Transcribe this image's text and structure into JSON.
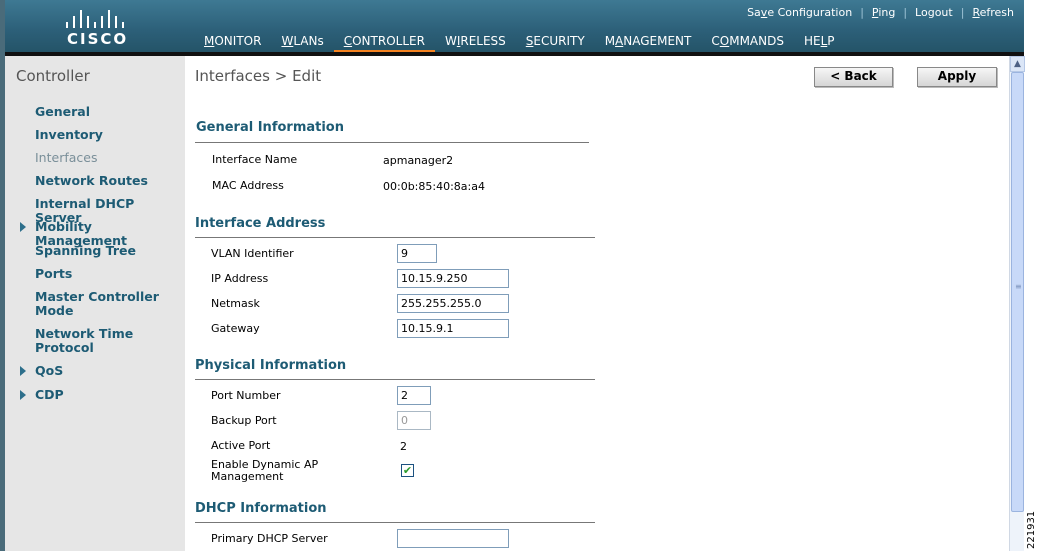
{
  "header": {
    "logo_text": "CISCO",
    "top_links": [
      {
        "pre": "Sa",
        "u": "v",
        "post": "e Configuration"
      },
      {
        "pre": "",
        "u": "P",
        "post": "ing"
      },
      {
        "pre": "Logout",
        "u": "",
        "post": ""
      },
      {
        "pre": "",
        "u": "R",
        "post": "efresh"
      }
    ],
    "menu": [
      {
        "pre": "",
        "u": "M",
        "post": "ONITOR"
      },
      {
        "pre": "",
        "u": "W",
        "post": "LANs"
      },
      {
        "pre": "",
        "u": "C",
        "post": "ONTROLLER"
      },
      {
        "pre": "W",
        "u": "I",
        "post": "RELESS"
      },
      {
        "pre": "",
        "u": "S",
        "post": "ECURITY"
      },
      {
        "pre": "M",
        "u": "A",
        "post": "NAGEMENT"
      },
      {
        "pre": "C",
        "u": "O",
        "post": "MMANDS"
      },
      {
        "pre": "HE",
        "u": "L",
        "post": "P"
      }
    ],
    "active_menu_index": 2
  },
  "sidebar": {
    "title": "Controller",
    "items": [
      "General",
      "Inventory",
      "Interfaces",
      "Network Routes",
      "Internal DHCP Server",
      "Mobility Management",
      "Spanning Tree",
      "Ports",
      "Master Controller Mode",
      "Network Time Protocol",
      "QoS",
      "CDP"
    ]
  },
  "main": {
    "breadcrumb": "Interfaces > Edit",
    "back_label": "< Back",
    "apply_label": "Apply",
    "general": {
      "title": "General Information",
      "name_label": "Interface Name",
      "name_value": "apmanager2",
      "mac_label": "MAC Address",
      "mac_value": "00:0b:85:40:8a:a4"
    },
    "address": {
      "title": "Interface Address",
      "vlan_label": "VLAN Identifier",
      "vlan_value": "9",
      "ip_label": "IP Address",
      "ip_value": "10.15.9.250",
      "netmask_label": "Netmask",
      "netmask_value": "255.255.255.0",
      "gateway_label": "Gateway",
      "gateway_value": "10.15.9.1"
    },
    "physical": {
      "title": "Physical Information",
      "port_label": "Port Number",
      "port_value": "2",
      "backup_label": "Backup Port",
      "backup_value": "0",
      "active_label": "Active Port",
      "active_value": "2",
      "dynamic_label": "Enable Dynamic AP Management",
      "dynamic_checked": true
    },
    "dhcp": {
      "title": "DHCP Information",
      "primary_label": "Primary DHCP Server",
      "primary_value": ""
    }
  },
  "figure_id": "221931",
  "colors": {
    "header": "#2c5f78",
    "accent": "#f58220",
    "section_title": "#1d5b74",
    "sidebar_bg": "#e6e6e6"
  }
}
